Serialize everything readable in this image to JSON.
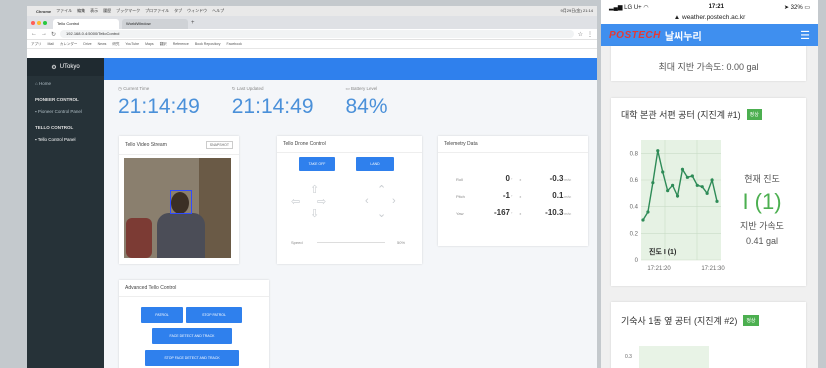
{
  "laptop": {
    "menubar": {
      "app": "Chrome",
      "items": [
        "ファイル",
        "編集",
        "表示",
        "履歴",
        "ブックマーク",
        "プロファイル",
        "タブ",
        "ウィンドウ",
        "ヘルプ"
      ],
      "clock": "9月29日(金) 21:14"
    },
    "tabs": [
      {
        "label": "Tello Control"
      },
      {
        "label": "WorldWindow"
      }
    ],
    "url": "192.168.0.4:5000/TelloControl",
    "bookmarks": [
      "アプリ",
      "Mail",
      "カレンダー",
      "Drive",
      "News",
      "研究",
      "YouTube",
      "Maps",
      "翻訳",
      "Reference",
      "Book Repository",
      "Facebook"
    ],
    "sidebar": {
      "brand": "UTokyo",
      "home": "Home",
      "section1": "PIONEER CONTROL",
      "item1": "Pioneer Control Panel",
      "section2": "TELLO CONTROL",
      "item2": "Tello Control Panel"
    },
    "stats": [
      {
        "label": "Current Time",
        "value": "21:14:49"
      },
      {
        "label": "Last Updated",
        "value": "21:14:49"
      },
      {
        "label": "Battery Level",
        "value": "84%"
      }
    ],
    "video": {
      "title": "Tello Video Stream",
      "snapshot": "SNAPSHOT"
    },
    "drone": {
      "title": "Tello Drone Control",
      "takeoff": "TAKE OFF",
      "land": "LAND",
      "speed_label": "Speed",
      "speed_value": "50%"
    },
    "telemetry": {
      "title": "Telemetry Data",
      "rows": [
        {
          "label": "Roll",
          "angle": "0",
          "accel": "-0.3"
        },
        {
          "label": "Pitch",
          "angle": "-1",
          "accel": "0.1"
        },
        {
          "label": "Yaw",
          "angle": "-167",
          "accel": "-10.3"
        }
      ],
      "deg": "°",
      "accel_unit": "m/s²",
      "x_label": "x"
    },
    "advanced": {
      "title": "Advanced Tello Control",
      "patrol": "PATROL",
      "stop_patrol": "STOP PATROL",
      "face_detect": "FACE DETECT AND TRACK",
      "stop_face": "STOP FACE DETECT AND TRACK"
    }
  },
  "phone": {
    "status": {
      "carrier": "LG U+",
      "time": "17:21",
      "battery": "32%"
    },
    "url": "weather.postech.ac.kr",
    "logo": "POSTECH",
    "site_title": "날씨누리",
    "top_text": "최대 지반 가속도: 0.00 gal",
    "card1": {
      "title": "대학 본관 서편 공터 (지진계 #1)",
      "badge": "정상",
      "intensity_label": "현재 진도",
      "intensity_value": "I (1)",
      "accel_label": "지반 가속도",
      "accel_value": "0.41 gal",
      "chart_label": "진도 I (1)"
    },
    "card2": {
      "title": "기숙사 1동 옆 공터 (지진계 #2)",
      "badge": "정상",
      "tick": "0.3"
    }
  },
  "chart_data": {
    "type": "line",
    "x": [
      "17:21:20",
      "17:21:30"
    ],
    "ylim": [
      0,
      0.9
    ],
    "yticks": [
      0,
      0.2,
      0.4,
      0.6,
      0.8
    ],
    "values": [
      0.3,
      0.36,
      0.58,
      0.82,
      0.66,
      0.52,
      0.56,
      0.48,
      0.68,
      0.62,
      0.63,
      0.56,
      0.55,
      0.5,
      0.6,
      0.44
    ],
    "label": "진도 I (1)",
    "color": "#2e8b57",
    "grid": true
  }
}
